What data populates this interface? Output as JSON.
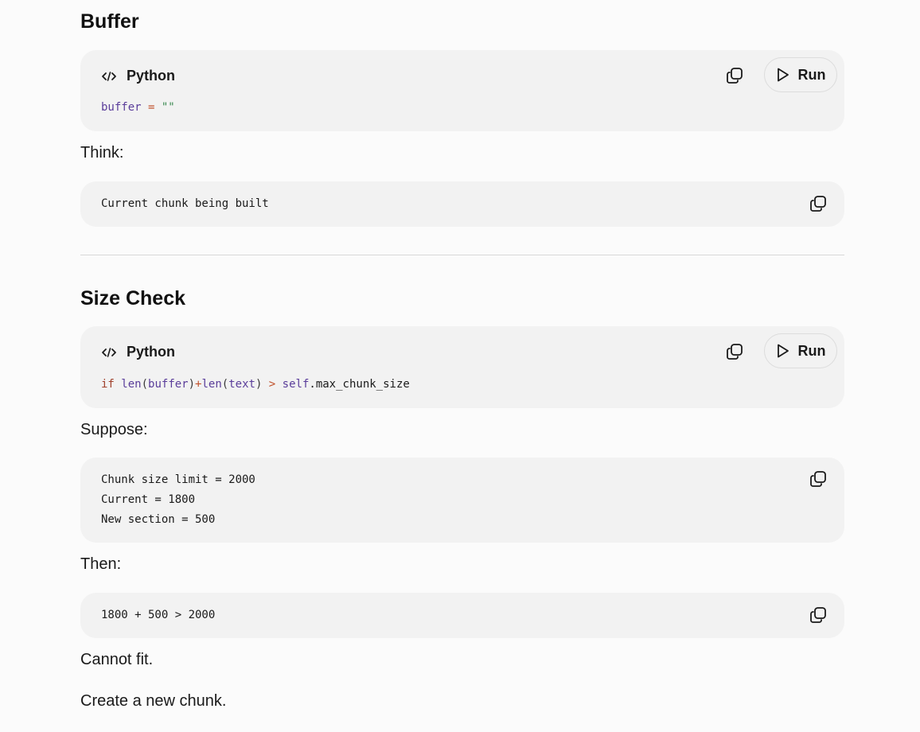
{
  "sections": {
    "buffer": {
      "heading": "Buffer",
      "code_block": {
        "language": "Python",
        "run_label": "Run",
        "code": {
          "t1": "buffer",
          "t2": " = ",
          "t3": "\"\""
        }
      },
      "think_label": "Think:",
      "plain_block": {
        "line1": "Current chunk being built"
      }
    },
    "size_check": {
      "heading": "Size Check",
      "code_block": {
        "language": "Python",
        "run_label": "Run",
        "code": {
          "t1": "if",
          "t2": " ",
          "t3": "len",
          "t4": "(",
          "t5": "buffer",
          "t6": ")",
          "t7": "+",
          "t8": "len",
          "t9": "(",
          "t10": "text",
          "t11": ")",
          "t12": " > ",
          "t13": "self",
          "t14": ".max_chunk_size"
        }
      },
      "suppose_label": "Suppose:",
      "suppose_block": {
        "line1": "Chunk size limit = 2000",
        "line2": "Current = 1800",
        "line3": "New section = 500"
      },
      "then_label": "Then:",
      "then_block": {
        "line1": "1800 + 500 > 2000"
      },
      "conclusion1": "Cannot fit.",
      "conclusion2": "Create a new chunk."
    }
  },
  "icons": {
    "code": "code-icon",
    "copy": "copy-icon",
    "play": "play-icon"
  },
  "colors": {
    "card_bg": "#f2f2f2",
    "page_bg": "#fbfbfb",
    "keyword": "#a0412c",
    "variable": "#5a3d9a",
    "string": "#3c8b52"
  }
}
